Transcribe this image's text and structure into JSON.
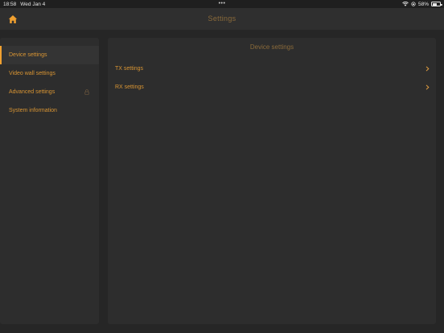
{
  "status": {
    "time": "18:58",
    "date": "Wed Jan 4",
    "battery": "58%",
    "battery_level": 0.58
  },
  "header": {
    "title": "Settings"
  },
  "sidebar": {
    "items": [
      {
        "label": "Device settings"
      },
      {
        "label": "Video wall settings"
      },
      {
        "label": "Advanced settings"
      },
      {
        "label": "System information"
      }
    ]
  },
  "panel": {
    "title": "Device settings",
    "rows": [
      {
        "label": "TX settings"
      },
      {
        "label": "RX settings"
      }
    ]
  },
  "colors": {
    "accent": "#f0a030",
    "text": "#d99533",
    "muted": "#8a6a3a",
    "background": "#262626",
    "panel": "#2d2d2d"
  }
}
